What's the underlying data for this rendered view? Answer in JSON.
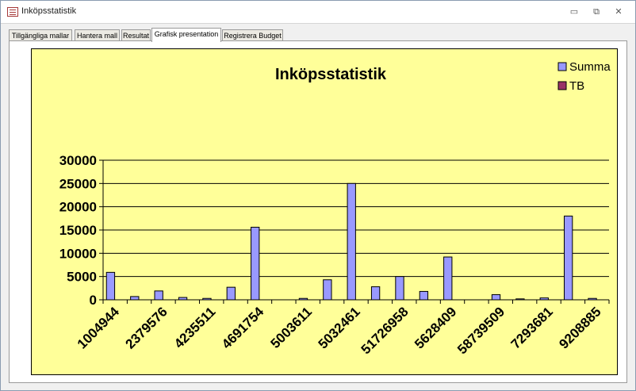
{
  "window": {
    "title": "Inköpsstatistik",
    "controls": {
      "minimize": "▭",
      "restore": "⧉",
      "close": "✕"
    }
  },
  "tabs": [
    {
      "label": "Tillgängliga mallar",
      "active": false
    },
    {
      "label": "Hantera mall",
      "active": false
    },
    {
      "label": "Resultat",
      "active": false
    },
    {
      "label": "Grafisk presentation",
      "active": true
    },
    {
      "label": "Registrera Budget",
      "active": false
    }
  ],
  "colors": {
    "chart_bg": "#ffff99",
    "summa": "#9999ff",
    "tb": "#993366",
    "window_border": "#8a9bb0"
  },
  "chart_data": {
    "type": "bar",
    "title": "Inköpsstatistik",
    "categories": [
      "1004944",
      "",
      "2379576",
      "",
      "4235511",
      "",
      "4691754",
      "",
      "5003611",
      "",
      "5032461",
      "",
      "51726958",
      "",
      "5628409",
      "",
      "58739509",
      "",
      "7293681",
      "",
      "9208885"
    ],
    "tick_labels": [
      "1004944",
      "2379576",
      "4235511",
      "4691754",
      "5003611",
      "5032461",
      "51726958",
      "5628409",
      "58739509",
      "7293681",
      "9208885"
    ],
    "series": [
      {
        "name": "Summa",
        "values": [
          5900,
          700,
          1900,
          500,
          300,
          2700,
          15600,
          0,
          300,
          4300,
          25000,
          2800,
          5000,
          1800,
          9200,
          0,
          1100,
          200,
          400,
          18000,
          300
        ]
      },
      {
        "name": "TB",
        "values": [
          0,
          0,
          0,
          0,
          0,
          0,
          0,
          0,
          0,
          0,
          0,
          0,
          0,
          0,
          0,
          0,
          0,
          0,
          0,
          0,
          0
        ]
      }
    ],
    "ylim": [
      0,
      30000
    ],
    "yticks": [
      0,
      5000,
      10000,
      15000,
      20000,
      25000,
      30000
    ],
    "grid": true,
    "legend": "top-right"
  }
}
